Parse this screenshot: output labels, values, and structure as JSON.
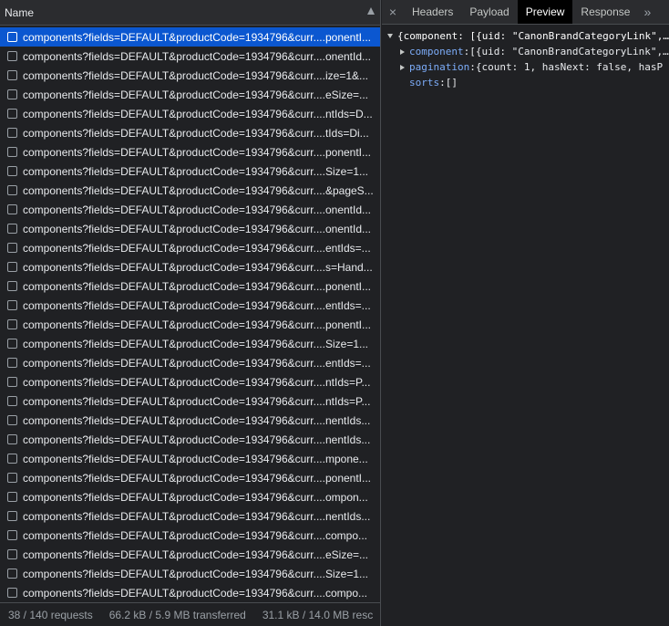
{
  "left_panel": {
    "header": {
      "label": "Name"
    },
    "rows": [
      {
        "text": "components?fields=DEFAULT&productCode=1934796&curr....ponentI...",
        "selected": true
      },
      {
        "text": "components?fields=DEFAULT&productCode=1934796&curr....onentId...",
        "selected": false
      },
      {
        "text": "components?fields=DEFAULT&productCode=1934796&curr....ize=1&...",
        "selected": false
      },
      {
        "text": "components?fields=DEFAULT&productCode=1934796&curr....eSize=...",
        "selected": false
      },
      {
        "text": "components?fields=DEFAULT&productCode=1934796&curr....ntIds=D...",
        "selected": false
      },
      {
        "text": "components?fields=DEFAULT&productCode=1934796&curr....tIds=Di...",
        "selected": false
      },
      {
        "text": "components?fields=DEFAULT&productCode=1934796&curr....ponentI...",
        "selected": false
      },
      {
        "text": "components?fields=DEFAULT&productCode=1934796&curr....Size=1...",
        "selected": false
      },
      {
        "text": "components?fields=DEFAULT&productCode=1934796&curr....&pageS...",
        "selected": false
      },
      {
        "text": "components?fields=DEFAULT&productCode=1934796&curr....onentId...",
        "selected": false
      },
      {
        "text": "components?fields=DEFAULT&productCode=1934796&curr....onentId...",
        "selected": false
      },
      {
        "text": "components?fields=DEFAULT&productCode=1934796&curr....entIds=...",
        "selected": false
      },
      {
        "text": "components?fields=DEFAULT&productCode=1934796&curr....s=Hand...",
        "selected": false
      },
      {
        "text": "components?fields=DEFAULT&productCode=1934796&curr....ponentI...",
        "selected": false
      },
      {
        "text": "components?fields=DEFAULT&productCode=1934796&curr....entIds=...",
        "selected": false
      },
      {
        "text": "components?fields=DEFAULT&productCode=1934796&curr....ponentI...",
        "selected": false
      },
      {
        "text": "components?fields=DEFAULT&productCode=1934796&curr....Size=1...",
        "selected": false
      },
      {
        "text": "components?fields=DEFAULT&productCode=1934796&curr....entIds=...",
        "selected": false
      },
      {
        "text": "components?fields=DEFAULT&productCode=1934796&curr....ntIds=P...",
        "selected": false
      },
      {
        "text": "components?fields=DEFAULT&productCode=1934796&curr....ntIds=P...",
        "selected": false
      },
      {
        "text": "components?fields=DEFAULT&productCode=1934796&curr....nentIds...",
        "selected": false
      },
      {
        "text": "components?fields=DEFAULT&productCode=1934796&curr....nentIds...",
        "selected": false
      },
      {
        "text": "components?fields=DEFAULT&productCode=1934796&curr....mpone...",
        "selected": false
      },
      {
        "text": "components?fields=DEFAULT&productCode=1934796&curr....ponentI...",
        "selected": false
      },
      {
        "text": "components?fields=DEFAULT&productCode=1934796&curr....ompon...",
        "selected": false
      },
      {
        "text": "components?fields=DEFAULT&productCode=1934796&curr....nentIds...",
        "selected": false
      },
      {
        "text": "components?fields=DEFAULT&productCode=1934796&curr....compo...",
        "selected": false
      },
      {
        "text": "components?fields=DEFAULT&productCode=1934796&curr....eSize=...",
        "selected": false
      },
      {
        "text": "components?fields=DEFAULT&productCode=1934796&curr....Size=1...",
        "selected": false
      },
      {
        "text": "components?fields=DEFAULT&productCode=1934796&curr....compo...",
        "selected": false
      }
    ],
    "status": {
      "requests": "38 / 140 requests",
      "transferred": "66.2 kB / 5.9 MB transferred",
      "resources": "31.1 kB / 14.0 MB resc"
    }
  },
  "right_panel": {
    "tabs": [
      {
        "label": "Headers",
        "active": false
      },
      {
        "label": "Payload",
        "active": false
      },
      {
        "label": "Preview",
        "active": true
      },
      {
        "label": "Response",
        "active": false
      }
    ],
    "close_glyph": "×",
    "more_glyph": "»",
    "preview": {
      "root": "{component: [{uid: \"CanonBrandCategoryLink\",…",
      "children": [
        {
          "key": "component",
          "value": " [{uid: \"CanonBrandCategoryLink\",…",
          "expandable": true
        },
        {
          "key": "pagination",
          "value": " {count: 1, hasNext: false, hasP",
          "expandable": true
        },
        {
          "key": "sorts",
          "value": " []",
          "expandable": false
        }
      ]
    }
  },
  "colors": {
    "selected_row": "#0b57d0",
    "key_color": "#7cacf8",
    "background": "#202124"
  }
}
